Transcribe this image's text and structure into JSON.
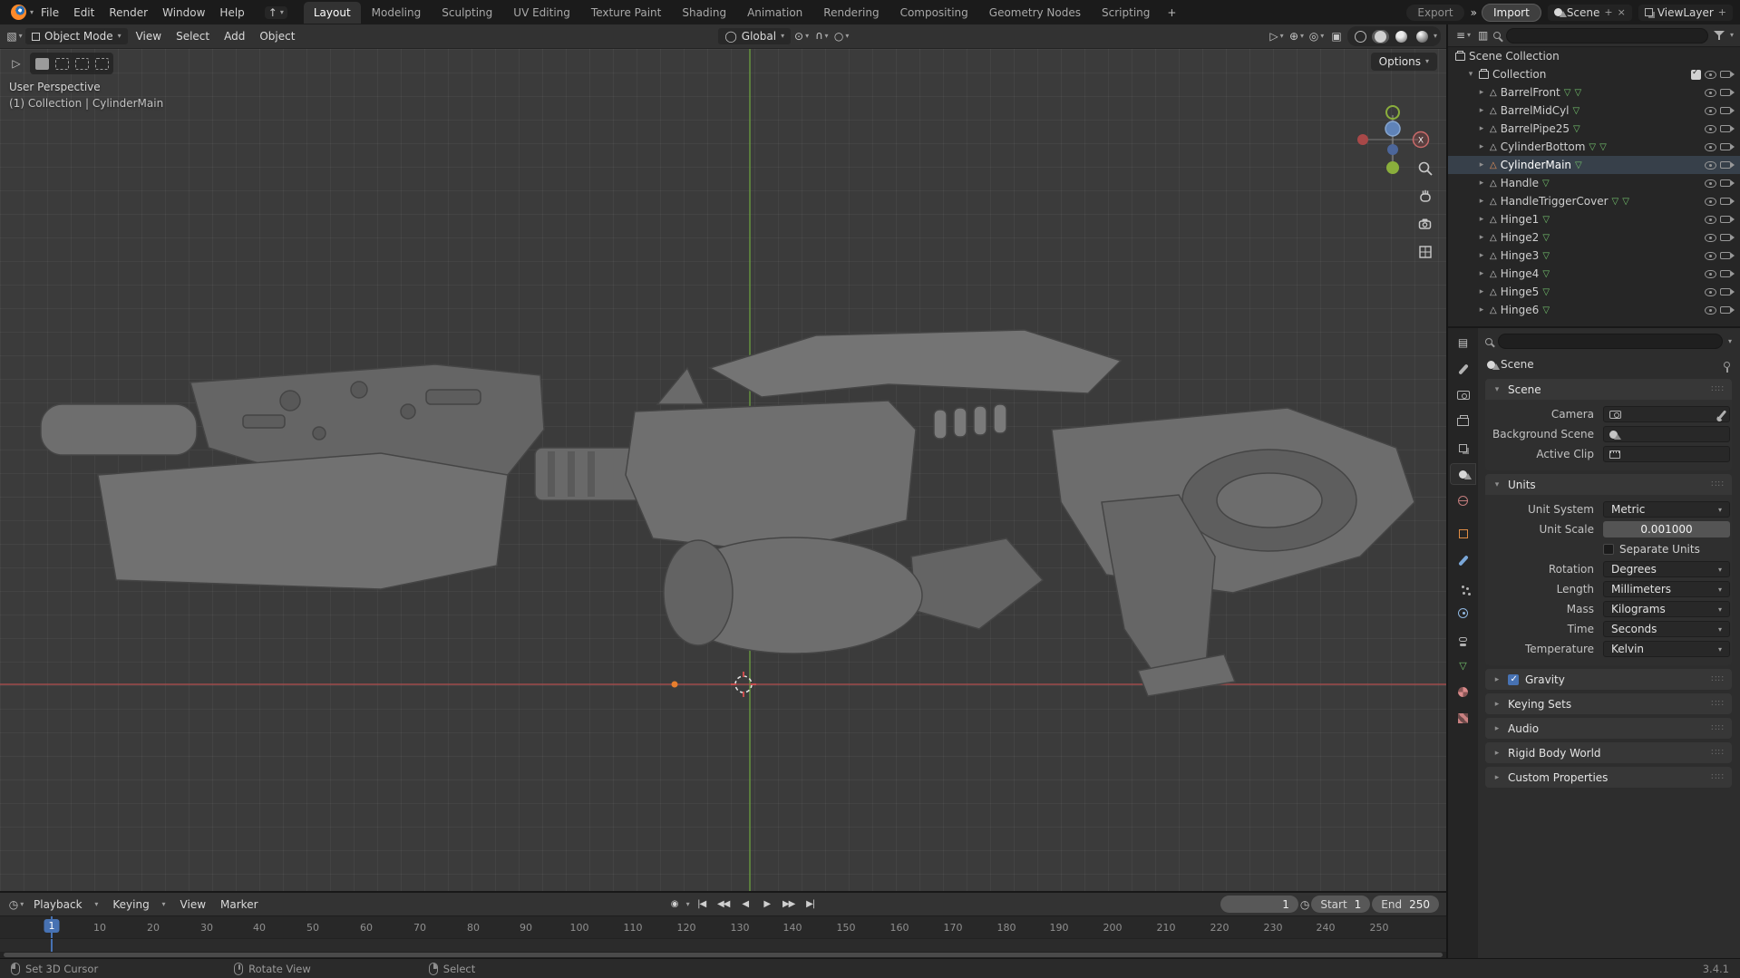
{
  "topbar": {
    "menus": [
      "File",
      "Edit",
      "Render",
      "Window",
      "Help"
    ],
    "workspaces": [
      "Layout",
      "Modeling",
      "Sculpting",
      "UV Editing",
      "Texture Paint",
      "Shading",
      "Animation",
      "Rendering",
      "Compositing",
      "Geometry Nodes",
      "Scripting"
    ],
    "add_workspace": "+",
    "export_label": "Export",
    "import_label": "Import",
    "chevrons": "»",
    "scene_name": "Scene",
    "viewlayer_name": "ViewLayer"
  },
  "viewport": {
    "mode": "Object Mode",
    "menus": [
      "View",
      "Select",
      "Add",
      "Object"
    ],
    "orientation": "Global",
    "options_label": "Options",
    "perspective_label": "User Perspective",
    "context_label": "(1) Collection | CylinderMain",
    "axis_x": "X"
  },
  "outliner": {
    "root": "Scene Collection",
    "collection": "Collection",
    "items": [
      "BarrelFront",
      "BarrelMidCyl",
      "BarrelPipe25",
      "CylinderBottom",
      "CylinderMain",
      "Handle",
      "HandleTriggerCover",
      "Hinge1",
      "Hinge2",
      "Hinge3",
      "Hinge4",
      "Hinge5",
      "Hinge6"
    ]
  },
  "properties": {
    "breadcrumb": "Scene",
    "panels": {
      "scene": "Scene",
      "units": "Units",
      "gravity": "Gravity",
      "keying_sets": "Keying Sets",
      "audio": "Audio",
      "rigid_body": "Rigid Body World",
      "custom": "Custom Properties"
    },
    "fields": {
      "camera_label": "Camera",
      "background_label": "Background Scene",
      "clip_label": "Active Clip",
      "unit_system_label": "Unit System",
      "unit_system_value": "Metric",
      "unit_scale_label": "Unit Scale",
      "unit_scale_value": "0.001000",
      "separate_units_label": "Separate Units",
      "rotation_label": "Rotation",
      "rotation_value": "Degrees",
      "length_label": "Length",
      "length_value": "Millimeters",
      "mass_label": "Mass",
      "mass_value": "Kilograms",
      "time_label": "Time",
      "time_value": "Seconds",
      "temperature_label": "Temperature",
      "temperature_value": "Kelvin"
    }
  },
  "timeline": {
    "menus": [
      "Playback",
      "Keying",
      "View",
      "Marker"
    ],
    "frame": "1",
    "playhead": "1",
    "start_label": "Start",
    "start_value": "1",
    "end_label": "End",
    "end_value": "250",
    "ticks": [
      "10",
      "20",
      "30",
      "40",
      "50",
      "60",
      "70",
      "80",
      "90",
      "100",
      "110",
      "120",
      "130",
      "140",
      "150",
      "160",
      "170",
      "180",
      "190",
      "200",
      "210",
      "220",
      "230",
      "240",
      "250"
    ]
  },
  "statusbar": {
    "hints": [
      "Set 3D Cursor",
      "Rotate View",
      "Select"
    ],
    "version": "3.4.1"
  },
  "icons": {
    "chevron": "▾",
    "expand_right": "▸",
    "expand_down": "▾",
    "mesh": "△",
    "meshdata": "▽",
    "menu": "≡",
    "grid_editor": "▧",
    "props_editor": "▤",
    "display_mode": "▥",
    "clock": "◷",
    "record": "◉",
    "jump_start": "|◀",
    "prev_key": "◀◀",
    "reverse": "◀",
    "play": "▶",
    "next_key": "▶▶",
    "jump_end": "▶|",
    "orientation": "◯",
    "pivot": "⊙",
    "snap": "∪",
    "proportional": "○",
    "cursor_arrow": "▷",
    "overlays": "◎",
    "gizmo": "⊕",
    "xray": "▣",
    "up": "↑",
    "close": "×",
    "new": "+"
  }
}
